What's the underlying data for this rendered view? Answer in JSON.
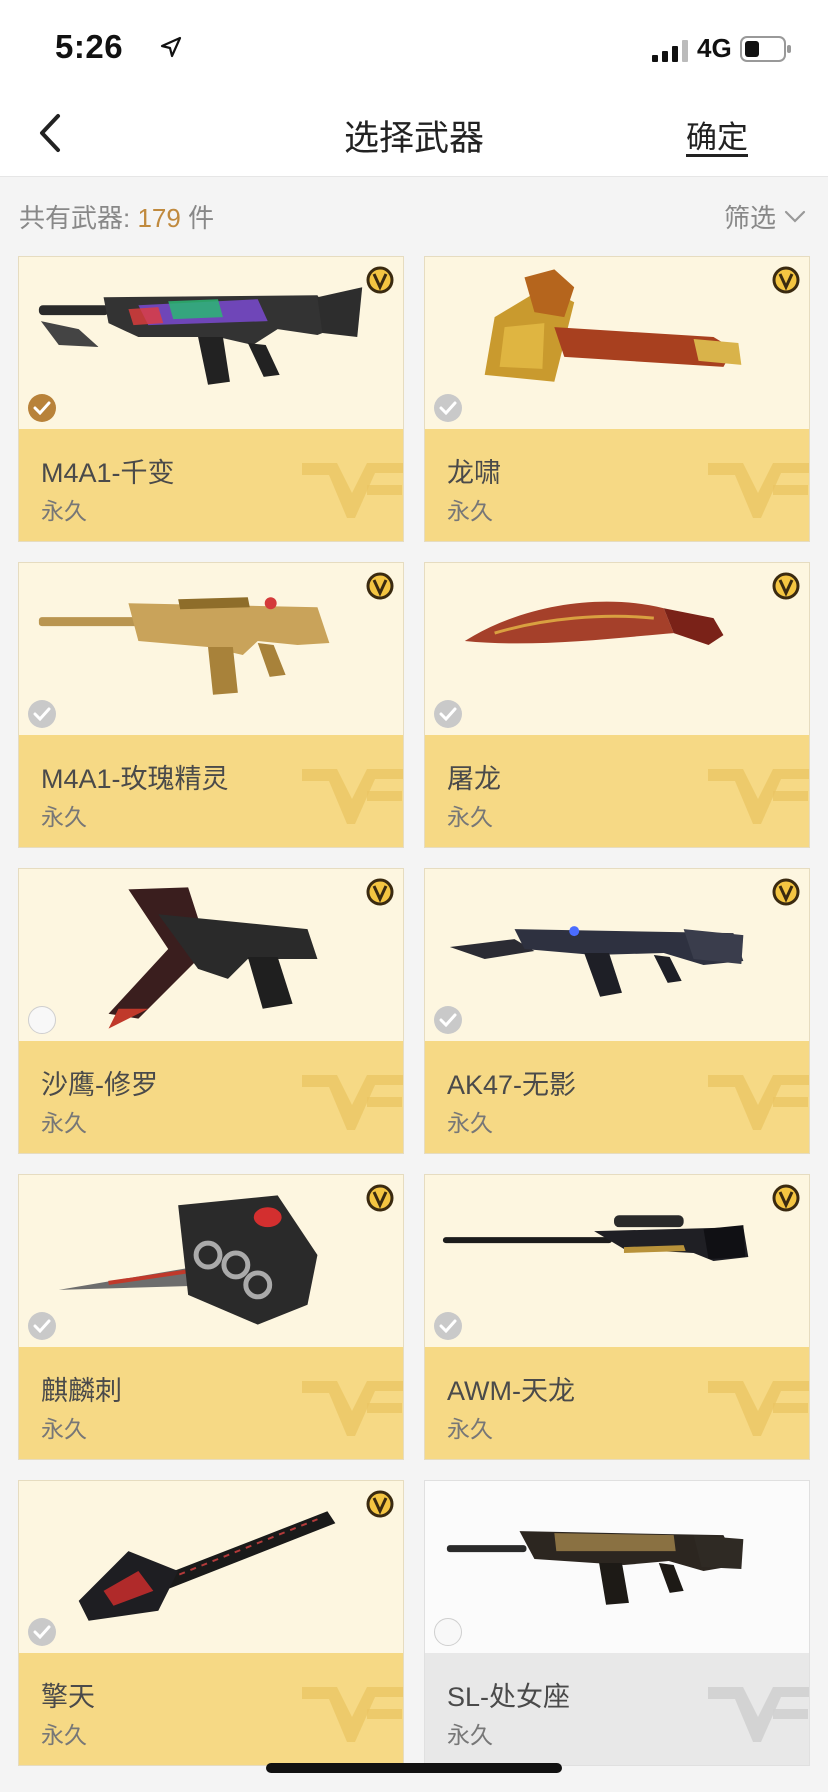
{
  "status_bar": {
    "time": "5:26",
    "network": "4G"
  },
  "nav": {
    "title": "选择武器",
    "confirm_label": "确定"
  },
  "summary": {
    "prefix": "共有武器: ",
    "count": "179",
    "suffix": " 件",
    "filter_label": "筛选"
  },
  "colors": {
    "accent": "#c08a3e",
    "card_bg": "#fdf6e0",
    "card_footer": "#f6d985",
    "selected": "#b8823a"
  },
  "weapons": [
    {
      "name": "M4A1-千变",
      "duration": "永久",
      "state": "selected",
      "vip": true,
      "icon": "rifle-icon"
    },
    {
      "name": "龙啸",
      "duration": "永久",
      "state": "disabled",
      "vip": true,
      "icon": "axe-icon"
    },
    {
      "name": "M4A1-玫瑰精灵",
      "duration": "永久",
      "state": "disabled",
      "vip": true,
      "icon": "rifle-icon"
    },
    {
      "name": "屠龙",
      "duration": "永久",
      "state": "disabled",
      "vip": true,
      "icon": "machete-icon"
    },
    {
      "name": "沙鹰-修罗",
      "duration": "永久",
      "state": "unselected",
      "vip": true,
      "icon": "pistol-icon"
    },
    {
      "name": "AK47-无影",
      "duration": "永久",
      "state": "disabled",
      "vip": true,
      "icon": "rifle-icon"
    },
    {
      "name": "麒麟刺",
      "duration": "永久",
      "state": "disabled",
      "vip": true,
      "icon": "knuckle-dagger-icon"
    },
    {
      "name": "AWM-天龙",
      "duration": "永久",
      "state": "disabled",
      "vip": true,
      "icon": "sniper-rifle-icon"
    },
    {
      "name": "擎天",
      "duration": "永久",
      "state": "disabled",
      "vip": true,
      "icon": "shovel-icon"
    },
    {
      "name": "SL-处女座",
      "duration": "永久",
      "state": "unselected",
      "vip": false,
      "icon": "rifle-icon"
    }
  ]
}
